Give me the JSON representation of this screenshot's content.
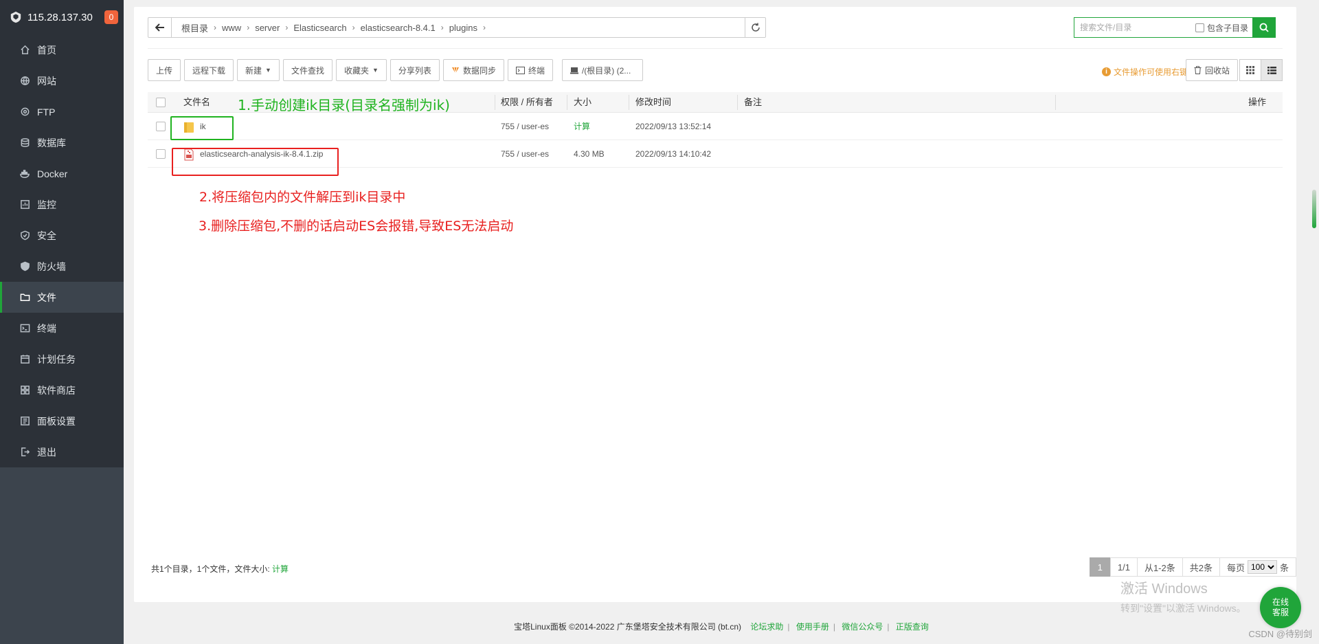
{
  "sidebar": {
    "ip": "115.28.137.30",
    "badge": "0",
    "items": [
      {
        "label": "首页",
        "icon": "home-icon"
      },
      {
        "label": "网站",
        "icon": "globe-icon"
      },
      {
        "label": "FTP",
        "icon": "ftp-icon"
      },
      {
        "label": "数据库",
        "icon": "database-icon"
      },
      {
        "label": "Docker",
        "icon": "docker-icon"
      },
      {
        "label": "监控",
        "icon": "monitor-icon"
      },
      {
        "label": "安全",
        "icon": "shield-check-icon"
      },
      {
        "label": "防火墙",
        "icon": "firewall-icon"
      },
      {
        "label": "文件",
        "icon": "folder-icon"
      },
      {
        "label": "终端",
        "icon": "terminal-icon"
      },
      {
        "label": "计划任务",
        "icon": "calendar-icon"
      },
      {
        "label": "软件商店",
        "icon": "apps-icon"
      },
      {
        "label": "面板设置",
        "icon": "settings-icon"
      },
      {
        "label": "退出",
        "icon": "logout-icon"
      }
    ],
    "active_index": 8
  },
  "breadcrumb": [
    "根目录",
    "www",
    "server",
    "Elasticsearch",
    "elasticsearch-8.4.1",
    "plugins"
  ],
  "search": {
    "placeholder": "搜索文件/目录",
    "include_sub": "包含子目录"
  },
  "toolbar": {
    "upload": "上传",
    "remote_download": "远程下载",
    "new": "新建",
    "find": "文件查找",
    "favorites": "收藏夹",
    "share_list": "分享列表",
    "sync": "数据同步",
    "terminal": "终端",
    "disk": "/(根目录) (2..."
  },
  "tip": "文件操作可使用右键",
  "recycle": "回收站",
  "table": {
    "headers": {
      "name": "文件名",
      "perm": "权限 / 所有者",
      "size": "大小",
      "mtime": "修改时间",
      "note": "备注",
      "ops": "操作"
    },
    "rows": [
      {
        "name": "ik",
        "type": "folder",
        "perm": "755 / user-es",
        "size": "计算",
        "mtime": "2022/09/13 13:52:14"
      },
      {
        "name": "elasticsearch-analysis-ik-8.4.1.zip",
        "type": "zip",
        "perm": "755 / user-es",
        "size": "4.30 MB",
        "mtime": "2022/09/13 14:10:42"
      }
    ]
  },
  "annotations": {
    "a1": "1.手动创建ik目录(目录名强制为ik)",
    "a2": "2.将压缩包内的文件解压到ik目录中",
    "a3": "3.删除压缩包,不删的话启动ES会报错,导致ES无法启动"
  },
  "footer": {
    "stats_prefix": "共1个目录，1个文件，文件大小:",
    "stats_link": "计算"
  },
  "pager": {
    "current": "1",
    "total_pages": "1/1",
    "range": "从1-2条",
    "total": "共2条",
    "per_page_label": "每页",
    "per_page": "100",
    "unit": "条"
  },
  "copyright": {
    "text": "宝塔Linux面板 ©2014-2022 广东堡塔安全技术有限公司 (bt.cn)",
    "links": [
      "论坛求助",
      "使用手册",
      "微信公众号",
      "正版查询"
    ]
  },
  "watermark": {
    "line1": "激活 Windows",
    "line2": "转到\"设置\"以激活 Windows。"
  },
  "kefu": {
    "line1": "在线",
    "line2": "客服"
  },
  "csdn": "CSDN @待别剑",
  "colors": {
    "brand_green": "#20a53a",
    "sidebar_bg": "#3c444d",
    "sidebar_header": "#2c3138",
    "annotation_green": "#1fb31f",
    "annotation_red": "#e8201f",
    "tip_orange": "#e89c34"
  }
}
